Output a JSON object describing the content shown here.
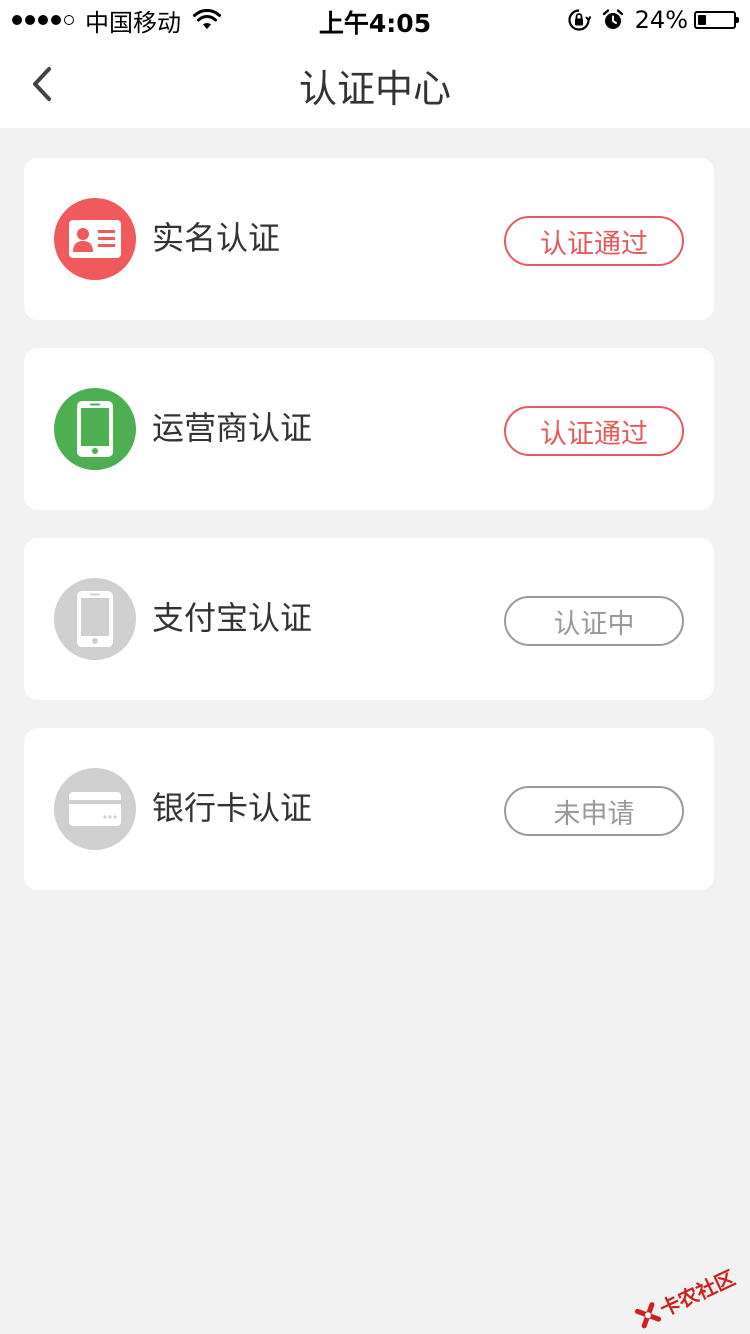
{
  "statusbar": {
    "carrier": "中国移动",
    "time": "上午4:05",
    "battery_percent_text": "24%",
    "battery_level": 0.24
  },
  "navbar": {
    "title": "认证中心"
  },
  "cards": [
    {
      "label": "实名认证",
      "status": "认证通过",
      "icon": "id-card-icon",
      "icon_color": "#f05a5a",
      "status_color": "#e85a5a"
    },
    {
      "label": "运营商认证",
      "status": "认证通过",
      "icon": "phone-icon",
      "icon_color": "#4caf50",
      "status_color": "#e85a5a"
    },
    {
      "label": "支付宝认证",
      "status": "认证中",
      "icon": "phone-icon",
      "icon_color": "#cfcfcf",
      "status_color": "#999999"
    },
    {
      "label": "银行卡认证",
      "status": "未申请",
      "icon": "bank-card-icon",
      "icon_color": "#cfcfcf",
      "status_color": "#999999"
    }
  ],
  "watermark": {
    "text": "卡农社区"
  }
}
